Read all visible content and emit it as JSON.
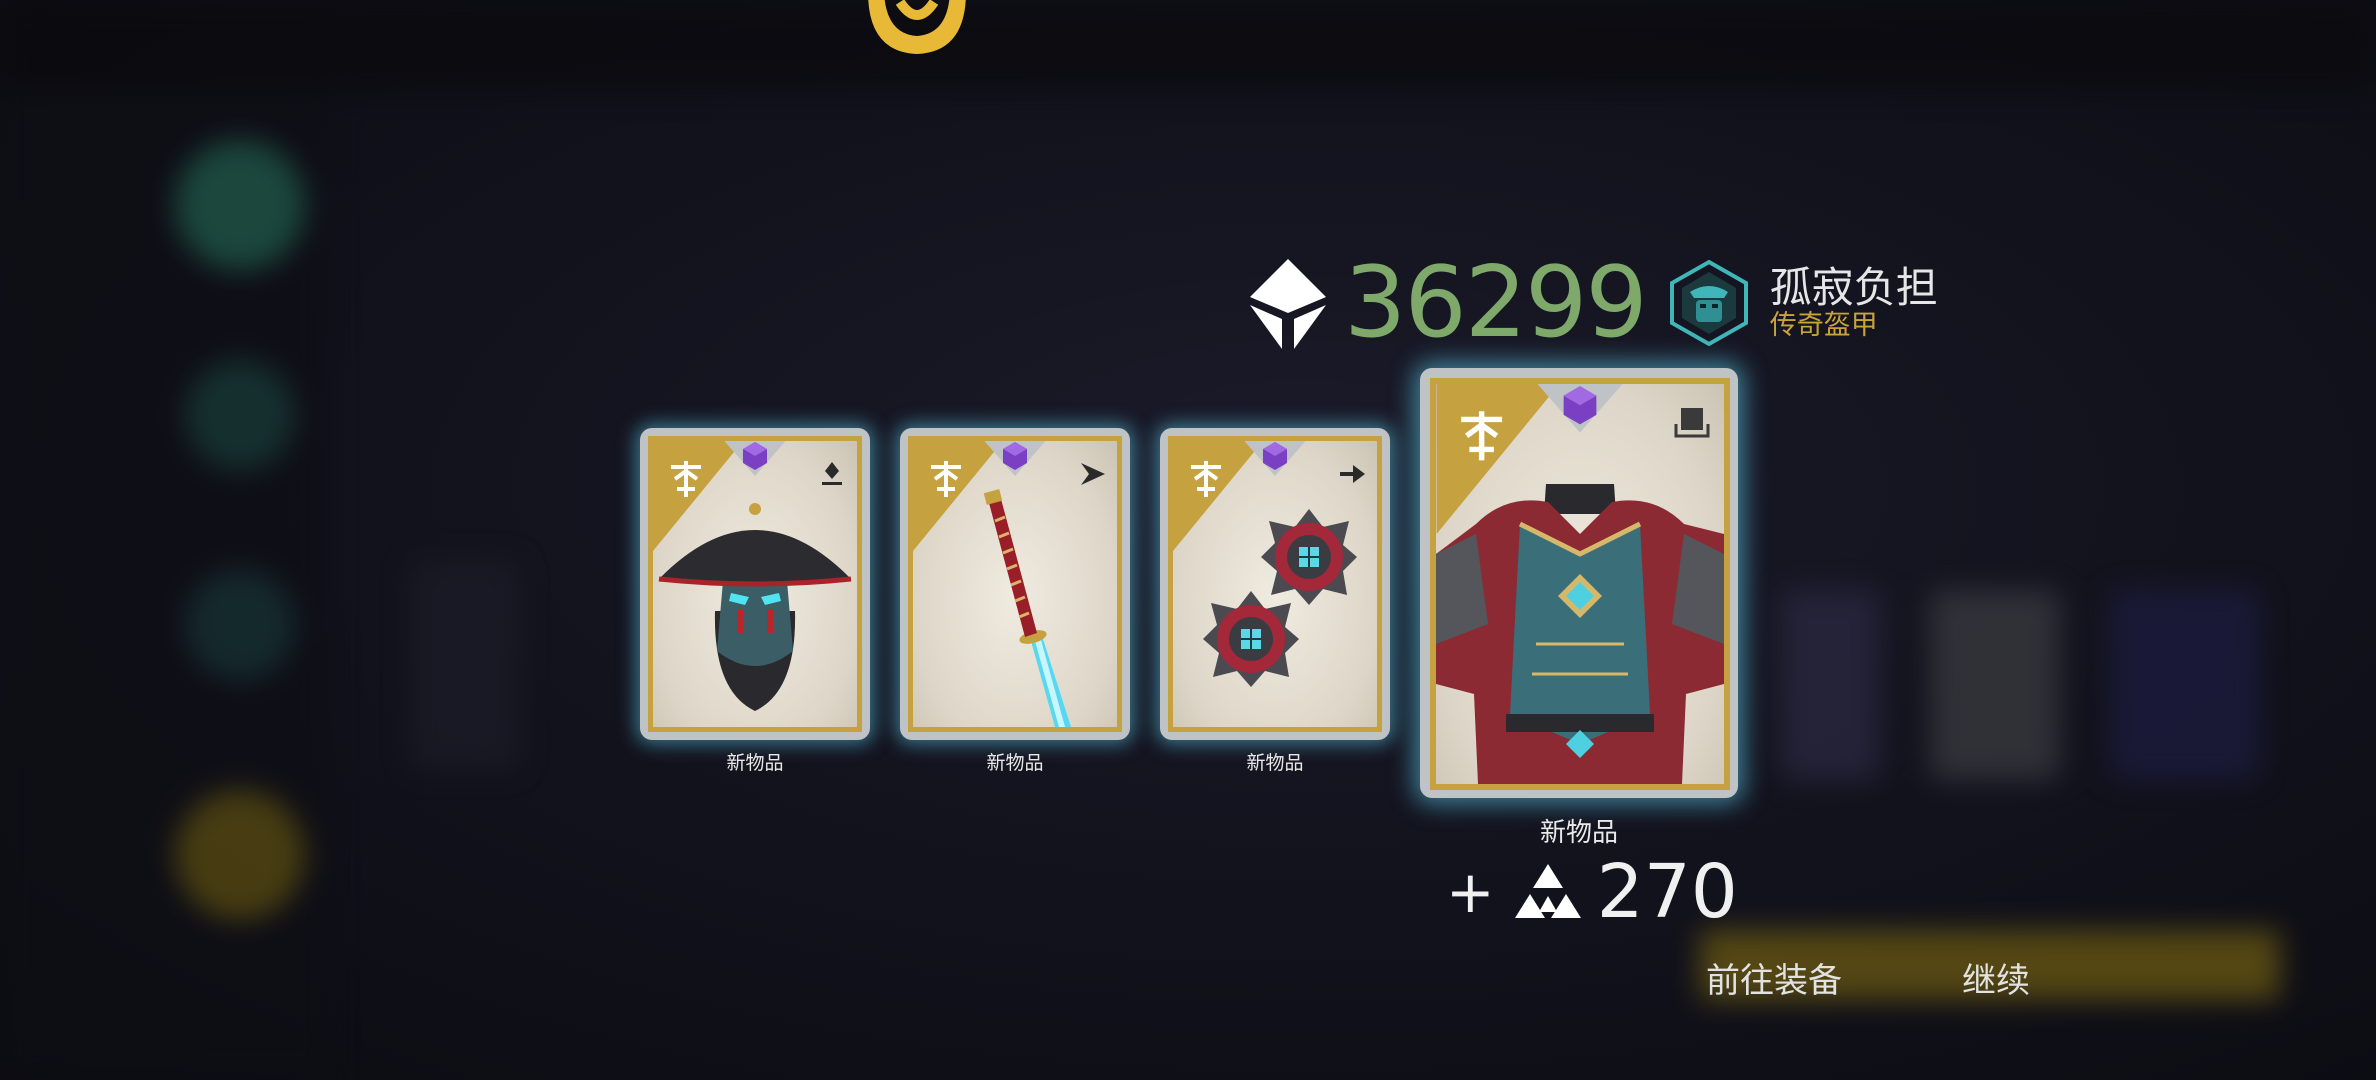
{
  "currency": {
    "icon": "diamond-currency-icon",
    "value": "36299",
    "color": "#7ea96a"
  },
  "set": {
    "emblem_icon": "teal-mask-emblem-icon",
    "name": "孤寂负担",
    "rarity": "传奇盔甲",
    "rarity_color": "#c9a23a"
  },
  "cards": [
    {
      "label": "新物品",
      "item_icon": "helmet-icon",
      "type_icon": "helmet-slot-icon",
      "rarity_icon": "purple-gem-icon"
    },
    {
      "label": "新物品",
      "item_icon": "katana-icon",
      "type_icon": "dash-slot-icon",
      "rarity_icon": "purple-gem-icon"
    },
    {
      "label": "新物品",
      "item_icon": "shuriken-icon",
      "type_icon": "arrow-slot-icon",
      "rarity_icon": "purple-gem-icon"
    },
    {
      "label": "新物品",
      "item_icon": "armor-icon",
      "type_icon": "armor-slot-icon",
      "rarity_icon": "purple-gem-icon"
    }
  ],
  "reward": {
    "prefix": "+",
    "icon": "triangle-currency-icon",
    "value": "270"
  },
  "actions": {
    "equip_label": "前往装备",
    "continue_label": "继续"
  },
  "colors": {
    "card_frame": "#c6a13f",
    "card_glow": "#5ac8e6",
    "card_bg": "#e8e2d6"
  }
}
